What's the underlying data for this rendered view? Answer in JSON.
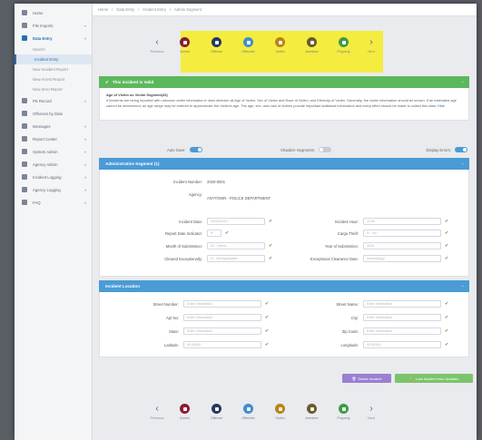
{
  "sidebar": {
    "items": [
      {
        "label": "Home",
        "type": "top"
      },
      {
        "label": "File Imports",
        "type": "top",
        "chev": "▾"
      },
      {
        "label": "Data Entry",
        "type": "top",
        "chev": "▾",
        "active": true
      },
      {
        "label": "Search",
        "type": "sub"
      },
      {
        "label": "Incident Entry",
        "type": "sub",
        "current": true
      },
      {
        "label": "New Incident Report",
        "type": "sub"
      },
      {
        "label": "New Arrest Report",
        "type": "sub"
      },
      {
        "label": "New Zero Report",
        "type": "sub"
      },
      {
        "label": "PE Record",
        "type": "top",
        "chev": "▾"
      },
      {
        "label": "Offenses by Date",
        "type": "top"
      },
      {
        "label": "Messages",
        "type": "top",
        "chev": "▾"
      },
      {
        "label": "Report Center",
        "type": "top",
        "chev": "▾"
      },
      {
        "label": "System Admin",
        "type": "top",
        "chev": "▾"
      },
      {
        "label": "Agency Admin",
        "type": "top",
        "chev": "▾"
      },
      {
        "label": "Incident Logging",
        "type": "top",
        "chev": "▾"
      },
      {
        "label": "Agency Logging",
        "type": "top",
        "chev": "▾"
      },
      {
        "label": "FAQ",
        "type": "top",
        "chev": "▾"
      }
    ]
  },
  "breadcrumb": [
    "Home",
    "Data Entry",
    "Incident Entry",
    "Admin Segment"
  ],
  "steps": [
    {
      "label": "Admin",
      "color": "#8b1c2c"
    },
    {
      "label": "Offense",
      "color": "#25385e"
    },
    {
      "label": "Offender",
      "color": "#3e8ed0"
    },
    {
      "label": "Victim",
      "color": "#b78418"
    },
    {
      "label": "Arrestee",
      "color": "#6a5a2e"
    },
    {
      "label": "Property",
      "color": "#3f9a47"
    }
  ],
  "nav": {
    "prev_label": "Previous",
    "next_label": "Next"
  },
  "warning": {
    "header": "This incident is Valid",
    "title": "Age of Victim on Victim Segment(33)",
    "text": "If incidents are being reported with unknown victim information it does diminish all Age of Victim, Sex of Victim and Race of Victim, and Ethnicity of Victim. Generally, the victim information should be known. If an estimated age cannot be determined, an age range may be entered to approximate the Victim's age. The age, sex, and race of victims provide important statistical information and every effort should be made to collect this data.",
    "more": "Hide"
  },
  "toggles": {
    "auto_save_label": "Auto Save:",
    "auto_save": "ON",
    "visualize_label": "Visualize Segments:",
    "visualize": "OFF",
    "display_errors_label": "Display Errors:",
    "display_errors": "ON"
  },
  "admin": {
    "header": "Administrative Segment (1)",
    "incident_number_label": "Incident Number:",
    "incident_number": "2020-0001",
    "agency_label": "Agency:",
    "agency_value": "ANYTOWN - POLICE DEPARTMENT",
    "incident_date_label": "Incident Date:",
    "incident_date": "03/05/2020",
    "incident_hour_label": "Incident Hour:",
    "incident_hour": "13:00",
    "report_date_label": "Report Date Indicator:",
    "report_date": "R",
    "cargo_theft_label": "Cargo Theft:",
    "cargo_theft": "N - No",
    "month_sub_label": "Month of Submission:",
    "month_sub": "03 - March",
    "year_sub_label": "Year of Submission:",
    "year_sub": "2020",
    "cleared_label": "Cleared Exceptionally:",
    "cleared": "N - Not Applicable",
    "ex_clear_date_label": "Exceptional Clearance Date:",
    "ex_clear_date": "mm/dd/yyyy"
  },
  "location": {
    "header": "Incident Location",
    "street_number_label": "Street Number:",
    "street_number_ph": "Enter Information",
    "street_name_label": "Street Name:",
    "street_name_ph": "Enter Information",
    "apt_label": "Apt No:",
    "apt_ph": "Enter Information",
    "city_label": "City:",
    "city_ph": "Enter Information",
    "state_label": "State:",
    "state_ph": "Enter Information",
    "zip_label": "Zip Code:",
    "zip_ph": "Enter Information",
    "lat_label": "Latitude:",
    "lat_ph": "00.00000",
    "lon_label": "Longitude:",
    "lon_ph": "00.00000"
  },
  "buttons": {
    "delete": "Delete Incident",
    "lock": "Lock Incident from Updates"
  }
}
